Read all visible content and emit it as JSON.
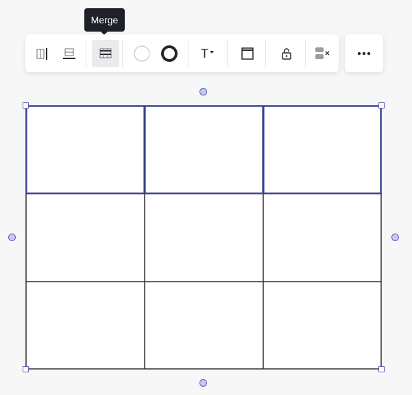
{
  "tooltip": {
    "text": "Merge"
  },
  "toolbar": {
    "buttons": [
      {
        "name": "insert-column-button",
        "icon": "column-insert-icon",
        "active": false
      },
      {
        "name": "insert-row-button",
        "icon": "row-insert-icon",
        "active": false
      },
      {
        "name": "merge-cells-button",
        "icon": "merge-cells-icon",
        "active": true
      },
      {
        "name": "fill-color-button",
        "icon": "fill-color-circle-icon",
        "active": false
      },
      {
        "name": "border-color-button",
        "icon": "border-color-ring-icon",
        "active": false
      },
      {
        "name": "text-format-button",
        "label": "T",
        "icon": "text-dropdown-icon",
        "active": false
      },
      {
        "name": "header-toggle-button",
        "icon": "table-header-icon",
        "active": false
      },
      {
        "name": "lock-button",
        "icon": "unlock-icon",
        "active": false
      },
      {
        "name": "delete-button",
        "icon": "delete-rows-icon",
        "active": false
      }
    ],
    "more": {
      "icon": "more-dots-icon"
    }
  },
  "table": {
    "rows": 3,
    "columns": 3,
    "selected_row": 1
  },
  "colors": {
    "selection": "#3a3f8f",
    "grid": "#2b2d31",
    "handle_fill": "#c7c9f2",
    "handle_stroke": "#5b5fb6",
    "tooltip_bg": "#1e2127",
    "active_button_bg": "#ebebed"
  }
}
